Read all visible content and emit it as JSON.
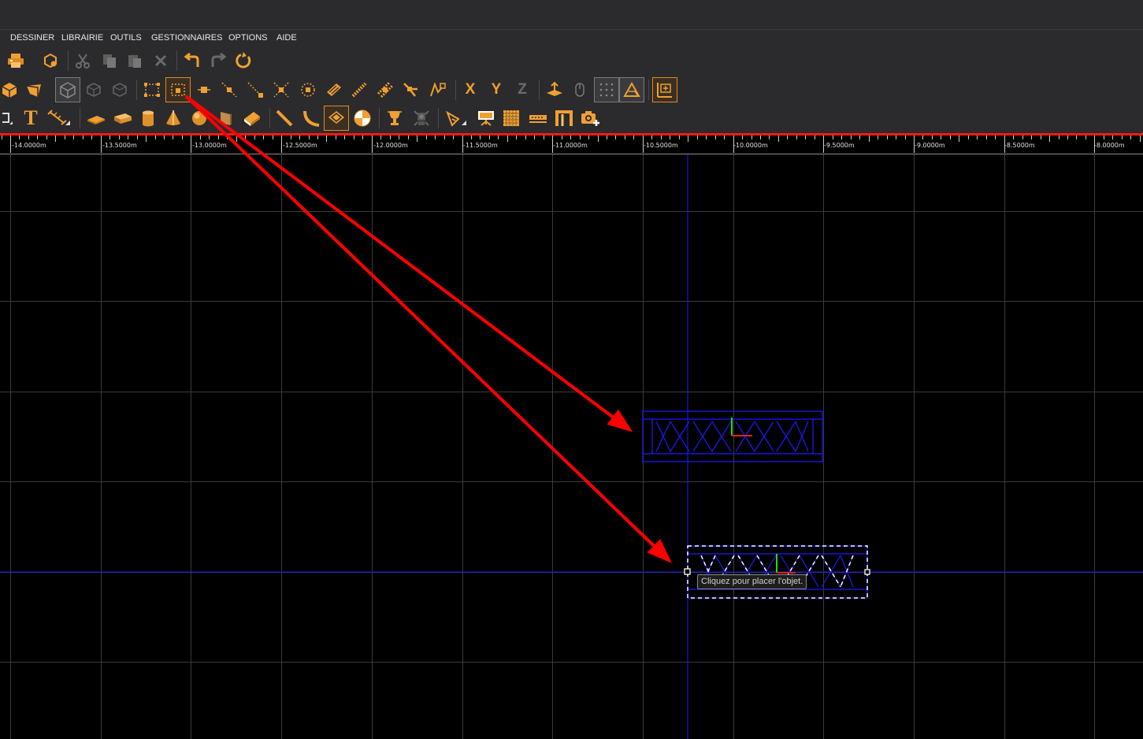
{
  "menu": [
    "DESSINER",
    "LIBRAIRIE",
    "OUTILS",
    "GESTIONNAIRES",
    "OPTIONS",
    "AIDE"
  ],
  "toolbar_axes": {
    "x": "X",
    "y": "Y",
    "z": "Z"
  },
  "toolbar_text_tool": "T",
  "ruler": {
    "labels": [
      "-14.0000m",
      "-13.5000m",
      "-13.0000m",
      "-12.5000m",
      "-12.0000m",
      "-11.5000m",
      "-11.0000m",
      "-10.5000m",
      "-10.0000m",
      "-9.5000m",
      "-9.0000m",
      "-8.5000m",
      "-8.0000m"
    ]
  },
  "tooltip": "Cliquez pour placer l'objet.",
  "colors": {
    "ui_background": "#2b2b2d",
    "accent_orange": "#f0a030",
    "ruler_red": "#ff1a1a",
    "grid": "#3a3a3a",
    "guide_blue": "#1a1aff",
    "annotation_arrow": "#ff0000"
  },
  "icons": {
    "row1": [
      "print-icon",
      "3d-settings-icon",
      "cut-icon",
      "copy-icon",
      "paste-icon",
      "delete-icon",
      "undo-icon",
      "redo-icon",
      "refresh-icon"
    ],
    "row2": [
      "cube-icon",
      "wedge-icon",
      "view-cube-icon",
      "view-iso-icon",
      "view-wire-icon",
      "select-box-icon",
      "select-point-icon",
      "snap-point-icon",
      "snap-line-icon",
      "snap-end-icon",
      "snap-cross-icon",
      "snap-center-icon",
      "snap-object-icon",
      "snap-tangent-icon",
      "snap-multi-icon",
      "snap-angle-icon",
      "snap-node-icon",
      "axis-x-icon",
      "axis-y-icon",
      "axis-z-icon",
      "elevation-icon",
      "mouse-icon",
      "grid-snap-icon",
      "plane-snap-icon",
      "dimension-icon"
    ],
    "row3": [
      "rect-tool-icon",
      "text-tool-icon",
      "measure-tool-icon",
      "plate-icon",
      "beam-icon",
      "cylinder-icon",
      "cone-icon",
      "sphere-icon",
      "panel-icon",
      "book-icon",
      "ruler-icon",
      "curve-icon",
      "truss-icon",
      "target-icon",
      "trophy-icon",
      "light-icon",
      "camera-view-icon",
      "screen-icon",
      "pattern-icon",
      "bar-icon",
      "portal-icon",
      "camera-add-icon"
    ]
  }
}
